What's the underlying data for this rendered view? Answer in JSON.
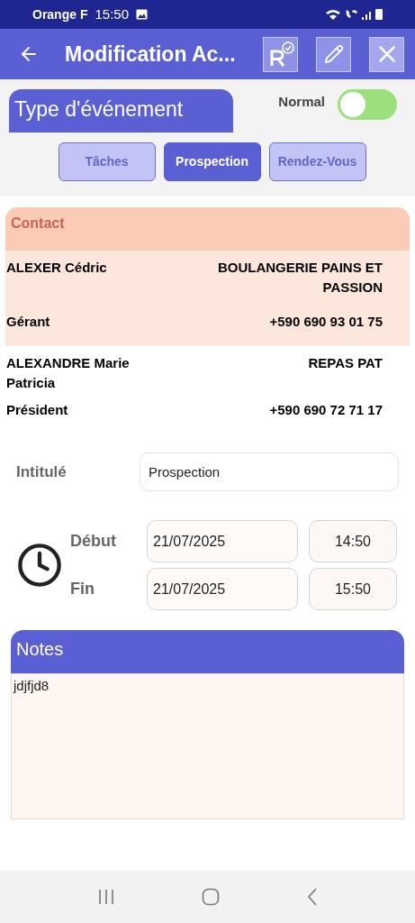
{
  "status_bar": {
    "carrier": "Orange F",
    "time": "15:50"
  },
  "app_bar": {
    "title": "Modification Ac..."
  },
  "event_type": {
    "title": "Type d'événement",
    "toggle_label": "Normal",
    "on": false,
    "tabs": [
      {
        "label": "Tâches",
        "selected": false
      },
      {
        "label": "Prospection",
        "selected": true
      },
      {
        "label": "Rendez-Vous",
        "selected": false
      }
    ]
  },
  "contacts": {
    "title": "Contact",
    "rows": [
      {
        "name": "ALEXER Cédric",
        "company": "BOULANGERIE PAINS ET PASSION",
        "role": "Gérant",
        "phone": "+590 690 93 01 75",
        "selected": true
      },
      {
        "name": "ALEXANDRE  Marie Patricia",
        "company": "REPAS PAT",
        "role": "Président",
        "phone": "+590 690 72 71 17",
        "selected": false
      }
    ]
  },
  "title_field": {
    "label": "Intitulé",
    "value": "Prospection"
  },
  "schedule": [
    {
      "label": "Début",
      "date": "21/07/2025",
      "time": "14:50"
    },
    {
      "label": "Fin",
      "date": "21/07/2025",
      "time": "15:50"
    }
  ],
  "notes": {
    "title": "Notes",
    "value": "jdjfjd8"
  }
}
